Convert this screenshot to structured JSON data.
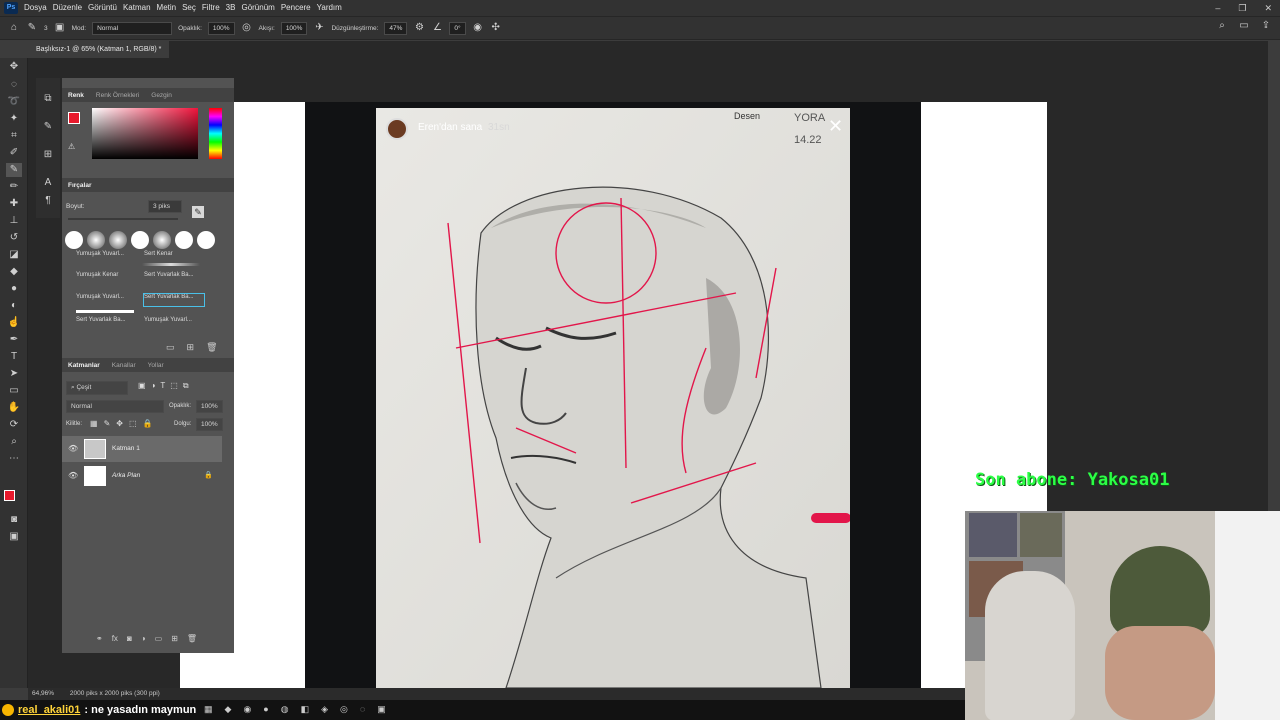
{
  "app": {
    "logo": "Ps"
  },
  "menu": [
    "Dosya",
    "Düzenle",
    "Görüntü",
    "Katman",
    "Metin",
    "Seç",
    "Filtre",
    "3B",
    "Görünüm",
    "Pencere",
    "Yardım"
  ],
  "window_controls": [
    "–",
    "❐",
    "✕"
  ],
  "options_bar": {
    "mode_label": "Mod:",
    "mode_value": "Normal",
    "opacity_label": "Opaklık:",
    "opacity_value": "100%",
    "flow_label": "Akışı:",
    "flow_value": "100%",
    "smoothing_label": "Düzgünleştirme:",
    "smoothing_value": "47%",
    "angle_value": "0°",
    "brush_size_small": "3"
  },
  "document_tab": "Başlıksız-1 @ 65% (Katman 1, RGB/8) *",
  "color_panel": {
    "tabs": [
      "Renk",
      "Renk Örnekleri",
      "Gezgin"
    ],
    "fg": "#e8192c",
    "bg": "#f2f2f2"
  },
  "brushes_panel": {
    "title": "Fırçalar",
    "size_label": "Boyut:",
    "size_value": "3 piks",
    "presets": [
      {
        "name": "Yumuşak Yuvarl..."
      },
      {
        "name": "Sert Kenar"
      },
      {
        "name": "Yumuşak Kenar"
      },
      {
        "name": "Sert Yuvarlak Ba..."
      },
      {
        "name": "Yumuşak Yuvarl..."
      },
      {
        "name": "Sert Yuvarlak Ba..."
      },
      {
        "name": "Sert Yuvarlak Ba..."
      },
      {
        "name": "Yumuşak Yuvarl..."
      }
    ]
  },
  "layers_panel": {
    "tabs": [
      "Katmanlar",
      "Kanallar",
      "Yollar"
    ],
    "filter_label": "Çeşit",
    "blend_mode": "Normal",
    "opacity_label": "Opaklık:",
    "opacity_value": "100%",
    "lock_label": "Kilitle:",
    "fill_label": "Dolgu:",
    "fill_value": "100%",
    "layers": [
      {
        "name": "Katman 1",
        "selected": true
      },
      {
        "name": "Arka Plan",
        "selected": false
      }
    ]
  },
  "story": {
    "user": "Eren'dan sana",
    "time": "31sn",
    "note1": "Desen",
    "note2": "YORA",
    "note3": "14.22"
  },
  "status": {
    "zoom": "64,96%",
    "doc": "2000 piks x 2000 piks (300 ppi)"
  },
  "stream": {
    "subscriber": "Son abone: Yakosa01",
    "chat_user": "real_akali01",
    "chat_msg": ": ne yasadın maymun"
  },
  "colors": {
    "accent_red": "#e8192c",
    "subscriber_green": "#2cff46",
    "chat_yellow": "#ffd43a"
  }
}
